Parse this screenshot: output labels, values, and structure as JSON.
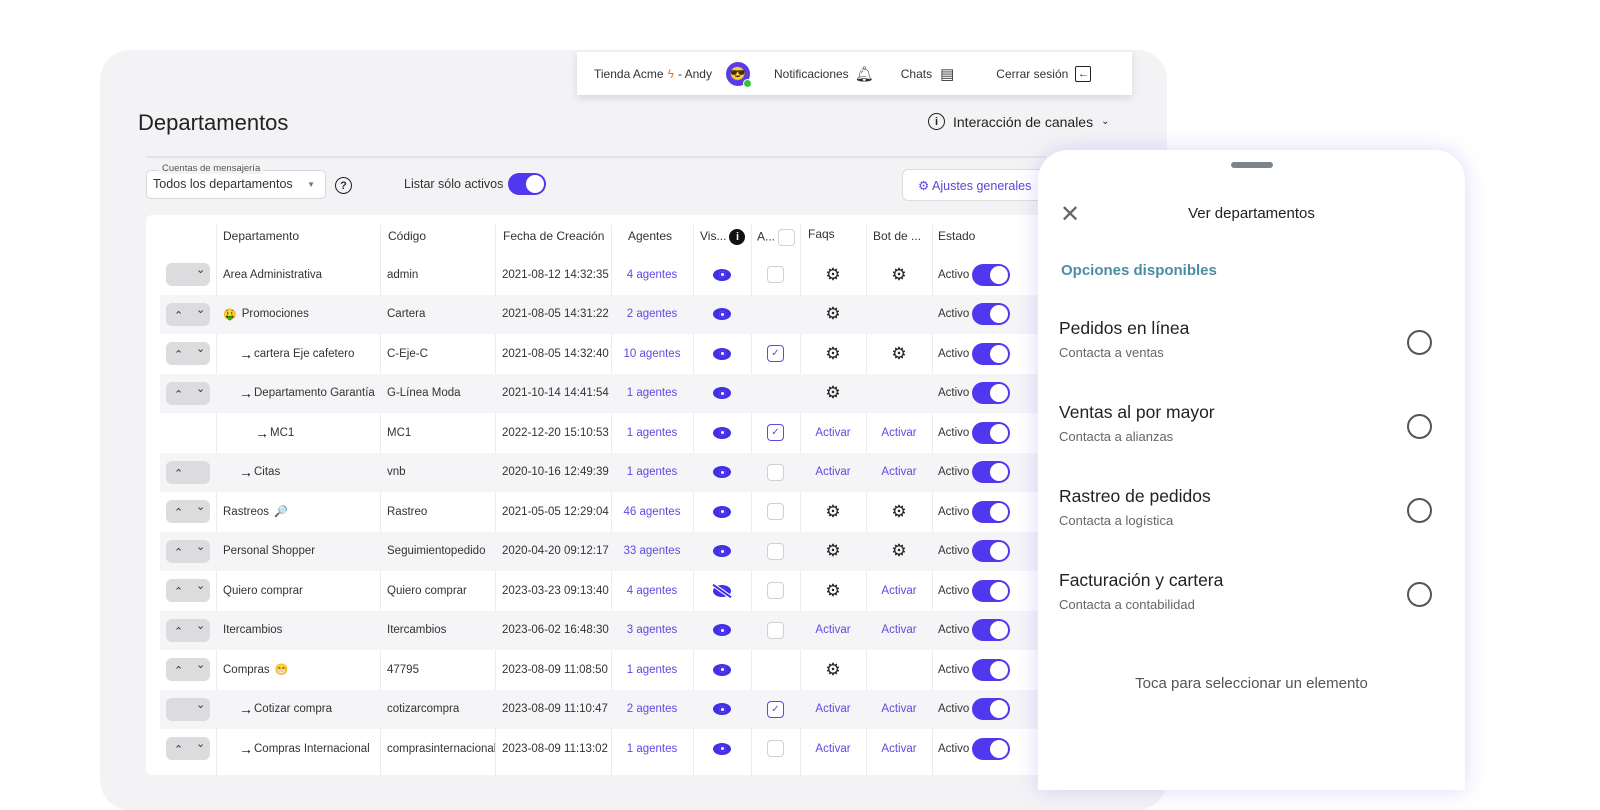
{
  "header": {
    "store": "Tienda Acme",
    "user": "- Andy",
    "notifications": "Notificaciones",
    "chats": "Chats",
    "logout": "Cerrar sesión"
  },
  "page": {
    "title": "Departamentos",
    "interaction": "Interacción de canales",
    "filter_label": "Cuentas de mensajería",
    "filter_value": "Todos los departamentos",
    "list_active": "Listar sólo activos",
    "list_active_on": true,
    "settings": "Ajustes generales"
  },
  "colors": {
    "accent": "#4f38ee",
    "panel_heading": "#4b8ea3"
  },
  "table": {
    "headers": [
      "Departamento",
      "Código",
      "Fecha de Creación",
      "Agentes",
      "Vis...",
      "A...",
      "Faqs",
      "Bot de ...",
      "Estado"
    ],
    "rows": [
      {
        "arrows": "down",
        "indent": 0,
        "emoji": "",
        "name": "Area Administrativa",
        "code": "admin",
        "date": "2021-08-12 14:32:35",
        "agents": "4 agentes",
        "visible": true,
        "check": "empty",
        "faqs": "gear",
        "bot": "gear",
        "status": "Activo"
      },
      {
        "arrows": "both",
        "indent": 0,
        "emoji": "🤑",
        "name": "Promociones",
        "code": "Cartera",
        "date": "2021-08-05 14:31:22",
        "agents": "2 agentes",
        "visible": true,
        "check": "none",
        "faqs": "gear",
        "bot": "none",
        "status": "Activo"
      },
      {
        "arrows": "both",
        "indent": 1,
        "emoji": "",
        "name": "cartera Eje cafetero",
        "code": "C-Eje-C",
        "date": "2021-08-05 14:32:40",
        "agents": "10 agentes",
        "visible": true,
        "check": "checked",
        "faqs": "gear",
        "bot": "gear",
        "status": "Activo"
      },
      {
        "arrows": "both",
        "indent": 1,
        "emoji": "",
        "name": "Departamento Garantía",
        "code": "G-Línea Moda",
        "date": "2021-10-14 14:41:54",
        "agents": "1 agentes",
        "visible": true,
        "check": "none",
        "faqs": "gear",
        "bot": "none",
        "status": "Activo"
      },
      {
        "arrows": "none",
        "indent": 2,
        "emoji": "",
        "name": "MC1",
        "code": "MC1",
        "date": "2022-12-20 15:10:53",
        "agents": "1 agentes",
        "visible": true,
        "check": "checked",
        "faqs": "Activar",
        "bot": "Activar",
        "status": "Activo"
      },
      {
        "arrows": "up",
        "indent": 1,
        "emoji": "",
        "name": "Citas",
        "code": "vnb",
        "date": "2020-10-16 12:49:39",
        "agents": "1 agentes",
        "visible": true,
        "check": "empty",
        "faqs": "Activar",
        "bot": "Activar",
        "status": "Activo"
      },
      {
        "arrows": "both",
        "indent": 0,
        "emoji": "🔎",
        "name": "Rastreos",
        "code": "Rastreo",
        "date": "2021-05-05 12:29:04",
        "agents": "46 agentes",
        "visible": true,
        "check": "empty",
        "faqs": "gear",
        "bot": "gear",
        "status": "Activo"
      },
      {
        "arrows": "both",
        "indent": 0,
        "emoji": "",
        "name": "Personal Shopper",
        "code": "Seguimientopedido",
        "date": "2020-04-20 09:12:17",
        "agents": "33 agentes",
        "visible": true,
        "check": "empty",
        "faqs": "gear",
        "bot": "gear",
        "status": "Activo"
      },
      {
        "arrows": "both",
        "indent": 0,
        "emoji": "",
        "name": "Quiero comprar",
        "code": "Quiero comprar",
        "date": "2023-03-23 09:13:40",
        "agents": "4 agentes",
        "visible": false,
        "check": "empty",
        "faqs": "gear",
        "bot": "Activar",
        "status": "Activo"
      },
      {
        "arrows": "both",
        "indent": 0,
        "emoji": "",
        "name": "Itercambios",
        "code": "Itercambios",
        "date": "2023-06-02 16:48:30",
        "agents": "3 agentes",
        "visible": true,
        "check": "empty",
        "faqs": "Activar",
        "bot": "Activar",
        "status": "Activo"
      },
      {
        "arrows": "both",
        "indent": 0,
        "emoji": "😁",
        "name": "Compras",
        "code": "47795",
        "date": "2023-08-09 11:08:50",
        "agents": "1 agentes",
        "visible": true,
        "check": "none",
        "faqs": "gear",
        "bot": "none",
        "status": "Activo"
      },
      {
        "arrows": "down",
        "indent": 1,
        "emoji": "",
        "name": "Cotizar compra",
        "code": "cotizarcompra",
        "date": "2023-08-09 11:10:47",
        "agents": "2 agentes",
        "visible": true,
        "check": "checked",
        "faqs": "Activar",
        "bot": "Activar",
        "status": "Activo"
      },
      {
        "arrows": "both",
        "indent": 1,
        "emoji": "",
        "name": "Compras Internacional",
        "code": "comprasinternacional",
        "date": "2023-08-09 11:13:02",
        "agents": "1 agentes",
        "visible": true,
        "check": "empty",
        "faqs": "Activar",
        "bot": "Activar",
        "status": "Activo"
      }
    ]
  },
  "panel": {
    "title": "Ver departamentos",
    "subtitle": "Opciones disponibles",
    "options": [
      {
        "title": "Pedidos en línea",
        "desc": "Contacta a ventas"
      },
      {
        "title": "Ventas al por mayor",
        "desc": "Contacta a alianzas"
      },
      {
        "title": "Rastreo de pedidos",
        "desc": "Contacta a logística"
      },
      {
        "title": "Facturación y cartera",
        "desc": "Contacta a contabilidad"
      }
    ],
    "hint": "Toca para seleccionar un elemento"
  }
}
